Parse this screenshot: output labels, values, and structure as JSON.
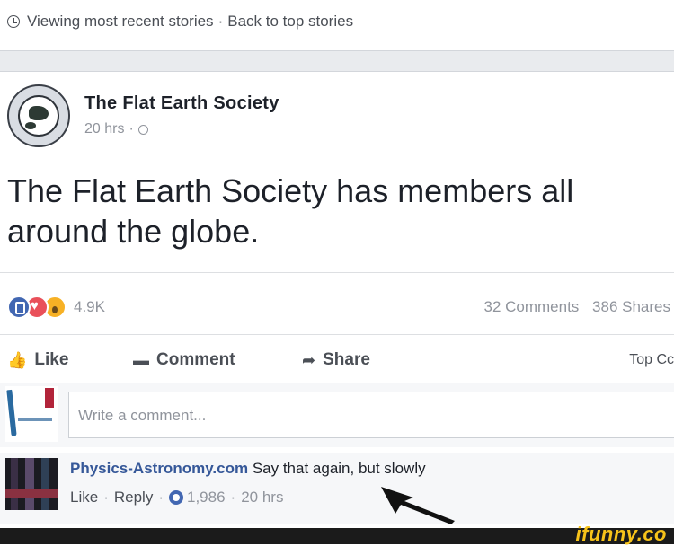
{
  "topbar": {
    "viewing_text": "Viewing most recent stories",
    "separator": "·",
    "back_link": "Back to top stories"
  },
  "post": {
    "page_name": "The Flat Earth Society",
    "time": "20 hrs",
    "time_separator": "·",
    "text": "The Flat Earth Society has members all around the globe.",
    "reaction_count": "4.9K",
    "comments_count": "32 Comments",
    "shares_count": "386 Shares",
    "actions": {
      "like": "Like",
      "comment": "Comment",
      "share": "Share",
      "top_comments": "Top Cc"
    },
    "comment_box_placeholder": "Write a comment..."
  },
  "comment": {
    "author": "Physics-Astronomy.com",
    "text": "Say that again, but slowly",
    "like_label": "Like",
    "reply_label": "Reply",
    "likes": "1,986",
    "time": "20 hrs",
    "separator": "·"
  },
  "footer": {
    "brand": "ifunny.co"
  },
  "colors": {
    "link_blue": "#365899",
    "like_blue": "#4267b2",
    "love_red": "#e9505a",
    "wow_yellow": "#f7b125",
    "brand_yellow": "#f7c31a"
  },
  "icons": {
    "clock": "clock-icon",
    "globe": "globe-icon",
    "like": "thumbs-up-icon",
    "comment": "speech-bubble-icon",
    "share": "share-arrow-icon"
  }
}
